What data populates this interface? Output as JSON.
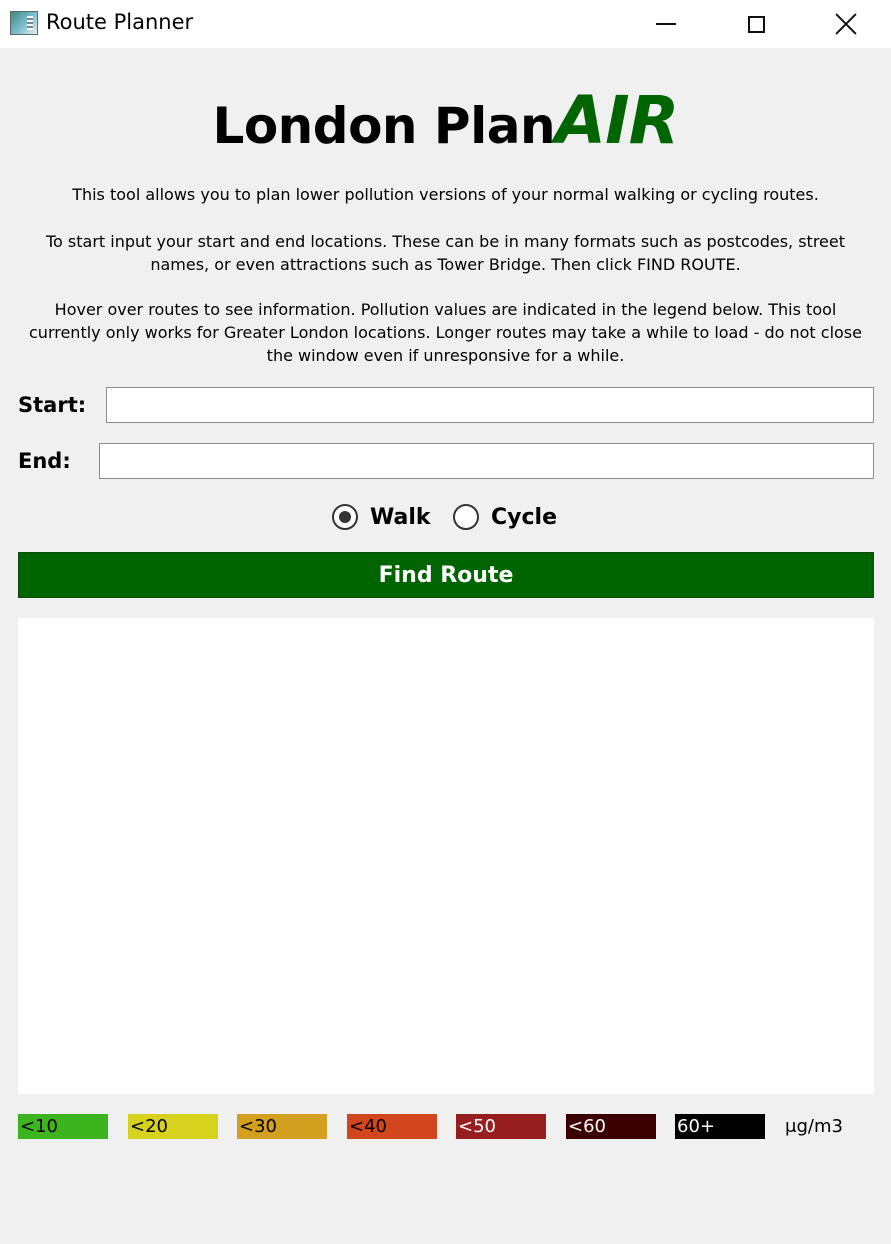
{
  "window": {
    "title": "Route Planner",
    "app_icon": "route-planner-app-icon"
  },
  "logo": {
    "main": "London Plan",
    "accent": "AIR",
    "accent_color": "#006400"
  },
  "description": {
    "line1": "This tool allows you to plan lower pollution versions of your normal walking or cycling routes.",
    "line2": "To start input your start and end locations. These can be in many formats such as postcodes, street names, or even attractions such as Tower Bridge. Then click FIND ROUTE.",
    "line3": "Hover over routes to see information. Pollution values are indicated in the legend below. This tool currently only works for Greater London locations. Longer routes may take a while to load - do not close the window even if unresponsive for a while."
  },
  "form": {
    "start_label": "Start:",
    "start_value": "",
    "end_label": "End:",
    "end_value": ""
  },
  "mode": {
    "walk_label": "Walk",
    "cycle_label": "Cycle",
    "selected": "Walk"
  },
  "find_button": {
    "label": "Find Route",
    "color": "#006400"
  },
  "legend": {
    "items": [
      {
        "label": "<10",
        "color": "#3cb41e",
        "text_color": "#000000"
      },
      {
        "label": "<20",
        "color": "#d7d21e",
        "text_color": "#000000"
      },
      {
        "label": "<30",
        "color": "#d2a01e",
        "text_color": "#000000"
      },
      {
        "label": "<40",
        "color": "#d2461e",
        "text_color": "#000000"
      },
      {
        "label": "<50",
        "color": "#961e1e",
        "text_color": "#ffffff"
      },
      {
        "label": "<60",
        "color": "#3c0000",
        "text_color": "#ffffff"
      },
      {
        "label": "60+",
        "color": "#000000",
        "text_color": "#ffffff"
      }
    ],
    "unit": "μg/m3"
  }
}
